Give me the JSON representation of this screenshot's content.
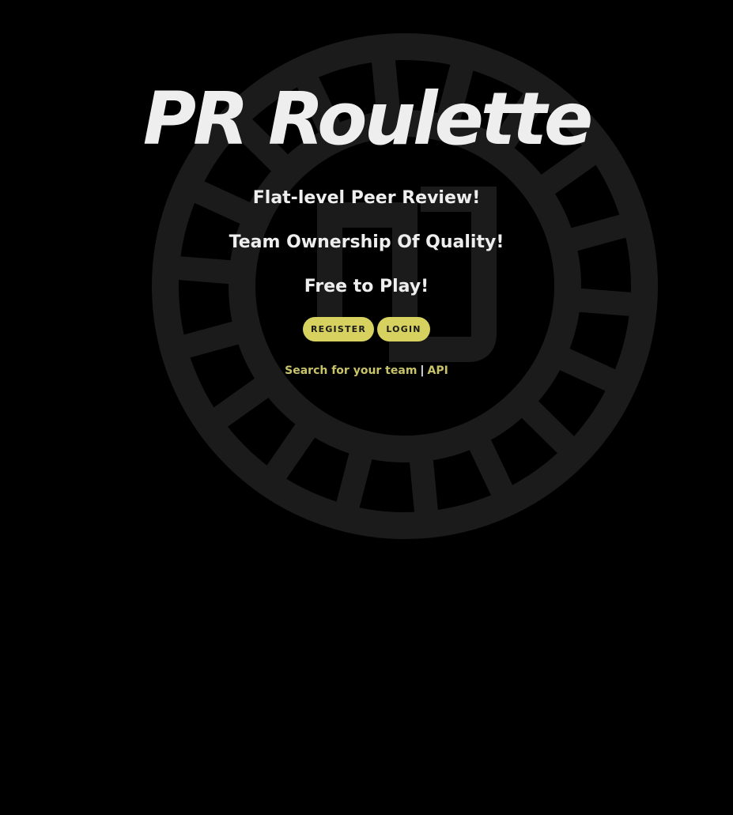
{
  "header": {
    "title": "PR Roulette"
  },
  "taglines": [
    "Flat-level Peer Review!",
    "Team Ownership Of Quality!",
    "Free to Play!"
  ],
  "actions": {
    "register_label": "REGISTER",
    "login_label": "LOGIN"
  },
  "links": {
    "search_team_label": "Search for your team",
    "separator": "|",
    "api_label": "API"
  },
  "icons": {
    "background": "roulette-wheel-logo-icon"
  },
  "colors": {
    "background": "#000000",
    "text": "#eeeeee",
    "accent": "#d7d260",
    "link": "#c9c36a",
    "logo": "#1b1b1b"
  }
}
